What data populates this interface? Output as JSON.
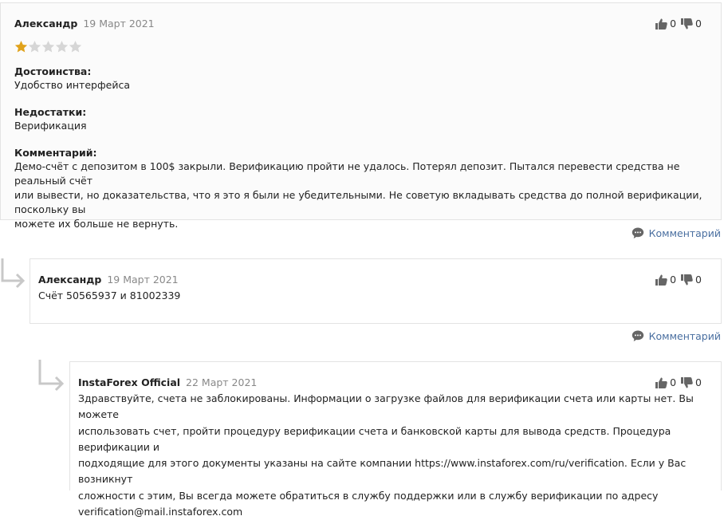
{
  "review": {
    "author": "Александр",
    "date": "19 Март 2021",
    "rating": 1,
    "rating_max": 5,
    "likes": "0",
    "dislikes": "0",
    "pros_label": "Достоинства:",
    "pros_text": "Удобство интерфейса",
    "cons_label": "Недостатки:",
    "cons_text": "Верификация",
    "comment_label": "Комментарий:",
    "comment_lines": [
      "Демо-счёт с депозитом в 100$ закрыли. Верификацию пройти не удалось. Потерял депозит. Пытался перевести средства не реальный счёт",
      "или вывести, но доказательства, что я это я были не убедительными. Не советую вкладывать средства до полной верификации, поскольку вы",
      "можете их больше не вернуть."
    ],
    "reply_link": "Комментарий"
  },
  "reply1": {
    "author": "Александр",
    "date": "19 Март 2021",
    "likes": "0",
    "dislikes": "0",
    "text": "Счёт 50565937 и 81002339",
    "reply_link": "Комментарий"
  },
  "reply2": {
    "author": "InstaForex Official",
    "date": "22 Март 2021",
    "likes": "0",
    "dislikes": "0",
    "lines": [
      "Здравствуйте, счета не заблокированы. Информации о загрузке файлов для верификации счета или карты нет. Вы можете",
      "использовать счет, пройти процедуру верификации счета и банковской карты для вывода средств. Процедура верификации и",
      "подходящие для этого документы указаны на сайте компании https://www.instaforex.com/ru/verification. Если у Вас возникнут",
      "сложности с этим, Вы всегда можете обратиться в службу поддержки или в службу верификации по адресу",
      "verification@mail.instaforex.com"
    ]
  },
  "colors": {
    "star_filled": "#e0a21b",
    "star_empty": "#d6d6d6",
    "link": "#4a6fa0",
    "icon": "#666666",
    "arrow": "#c8c8c8"
  }
}
